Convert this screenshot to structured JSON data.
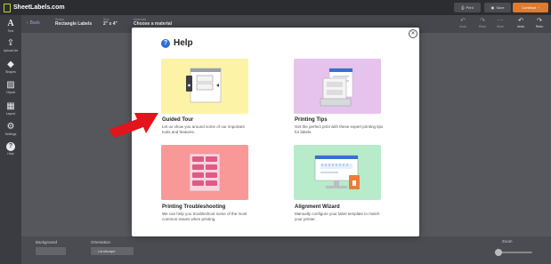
{
  "app": {
    "logo_text": "SheetLabels.com"
  },
  "topbar": {
    "print_label": "Print",
    "save_label": "Save",
    "continue_label": "Continue"
  },
  "sidebar": {
    "items": [
      {
        "label": "Text",
        "icon": "text-icon"
      },
      {
        "label": "Upload Art",
        "icon": "upload-icon"
      },
      {
        "label": "Shapes",
        "icon": "shapes-icon"
      },
      {
        "label": "Clipart",
        "icon": "image-icon"
      },
      {
        "label": "Layout",
        "icon": "layout-icon"
      },
      {
        "label": "Settings",
        "icon": "gear-icon"
      },
      {
        "label": "Help",
        "icon": "help-icon"
      }
    ]
  },
  "toolbar": {
    "back_label": "Back",
    "shape_label": "Shape",
    "shape_value": "Rectangle Labels",
    "size_label": "Size",
    "size_value": "2\" x 4\"",
    "template_label": "Materials",
    "template_value": "Choose a material",
    "tools": [
      {
        "label": "Undo",
        "icon": "undo-icon"
      },
      {
        "label": "Redo",
        "icon": "redo-icon"
      },
      {
        "label": "More",
        "icon": "more-icon"
      },
      {
        "label": "Undo",
        "icon": "undo-icon"
      },
      {
        "label": "Redo",
        "icon": "redo-icon"
      }
    ]
  },
  "bottombar": {
    "background_label": "Background",
    "background_value": "",
    "orientation_label": "Orientation",
    "orientation_value": "Landscape",
    "zoom_label": "Zoom",
    "zoom_value": 0.1
  },
  "modal": {
    "title": "Help",
    "cards": [
      {
        "title": "Guided Tour",
        "desc": "Let us show you around some of our important tools and features.",
        "bg": "#fdf3a6"
      },
      {
        "title": "Printing Tips",
        "desc": "Get the perfect print with these expert printing tips for labels.",
        "bg": "#e5c3ec"
      },
      {
        "title": "Printing Troubleshooting",
        "desc": "We can help you troubleshoot some of the most common issues when printing.",
        "bg": "#f89897"
      },
      {
        "title": "Alignment Wizard",
        "desc": "Manually configure your label template to match your printer.",
        "bg": "#b7ebc9"
      }
    ]
  },
  "colors": {
    "accent": "#2f6fd6",
    "continue": "#e07a2c",
    "arrow": "#e3141b"
  }
}
